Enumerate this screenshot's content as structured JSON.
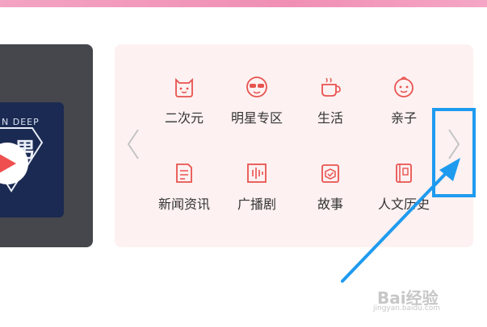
{
  "accent": "#e8534f",
  "highlight_color": "#1e9bef",
  "album": {
    "text": "N DEEP"
  },
  "categories": [
    {
      "label": "二次元",
      "icon": "cat-face-icon"
    },
    {
      "label": "明星专区",
      "icon": "sunglasses-face-icon"
    },
    {
      "label": "生活",
      "icon": "coffee-cup-icon"
    },
    {
      "label": "亲子",
      "icon": "baby-face-icon"
    },
    {
      "label": "新闻资讯",
      "icon": "newspaper-icon"
    },
    {
      "label": "广播剧",
      "icon": "audio-wave-icon"
    },
    {
      "label": "故事",
      "icon": "story-book-icon"
    },
    {
      "label": "人文历史",
      "icon": "history-book-icon"
    }
  ],
  "watermark": {
    "brand": "Bai经验",
    "url": "jingyan.baidu.com"
  }
}
